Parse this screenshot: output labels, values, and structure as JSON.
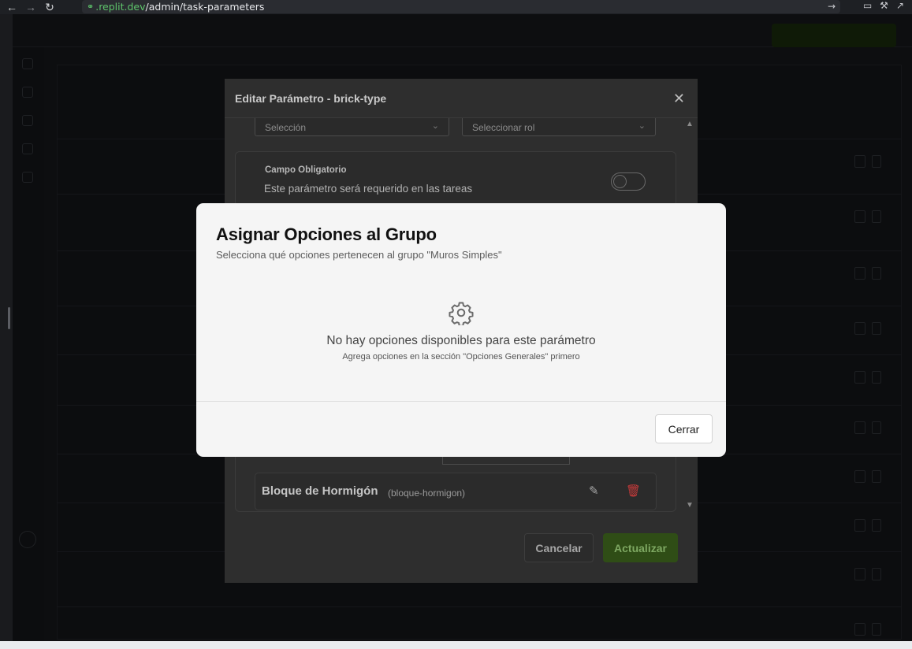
{
  "browser": {
    "url_host": ".replit.dev",
    "url_path": "/admin/task-parameters",
    "back_icon": "back-arrow-icon",
    "forward_icon": "forward-arrow-icon",
    "reload_icon": "reload-icon"
  },
  "edit_dialog": {
    "title": "Editar Parámetro - brick-type",
    "select_type_placeholder": "Selección",
    "select_role_placeholder": "Seleccionar rol",
    "required_title": "Campo Obligatorio",
    "required_desc": "Este parámetro será requerido en las tareas",
    "option_name": "Bloque de Hormigón",
    "option_code": "(bloque-hormigon)",
    "cancel_label": "Cancelar",
    "update_label": "Actualizar"
  },
  "assign_modal": {
    "title": "Asignar Opciones al Grupo",
    "subtitle": "Selecciona qué opciones pertenecen al grupo \"Muros Simples\"",
    "empty_message": "No hay opciones disponibles para este parámetro",
    "empty_hint": "Agrega opciones en la sección \"Opciones Generales\" primero",
    "close_label": "Cerrar",
    "icon": "gear-icon"
  },
  "colors": {
    "modal_bg": "#f5f5f5",
    "accent_green": "#2f4d16",
    "danger_red": "#c73a3a",
    "url_host_green": "#5ec46b"
  }
}
